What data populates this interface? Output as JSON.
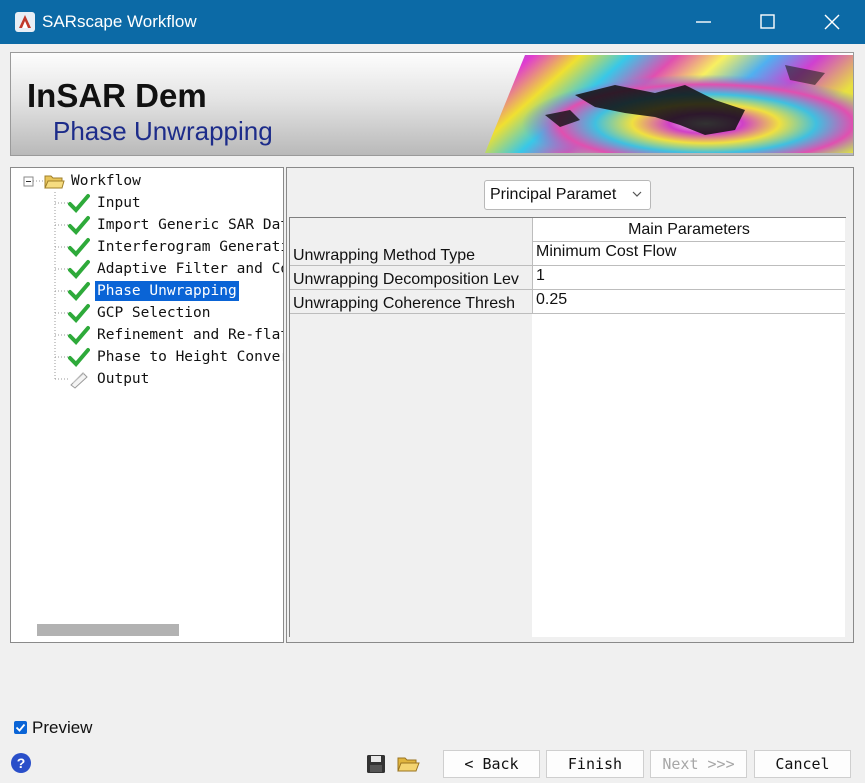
{
  "window": {
    "title": "SARscape Workflow"
  },
  "banner": {
    "title": "InSAR Dem",
    "subtitle": "Phase Unwrapping"
  },
  "tree": {
    "root": "Workflow",
    "items": [
      {
        "label": "Input",
        "status": "done"
      },
      {
        "label": "Import Generic SAR Data",
        "status": "done"
      },
      {
        "label": "Interferogram Generation",
        "status": "done"
      },
      {
        "label": "Adaptive Filter and Coh",
        "status": "done"
      },
      {
        "label": "Phase Unwrapping",
        "status": "done",
        "selected": true
      },
      {
        "label": "GCP Selection",
        "status": "done"
      },
      {
        "label": "Refinement and Re-flatt",
        "status": "done"
      },
      {
        "label": "Phase to Height Convers",
        "status": "done"
      },
      {
        "label": "Output",
        "status": "pending"
      }
    ]
  },
  "params": {
    "selector": "Principal Paramet",
    "header": "Main Parameters",
    "rows": [
      {
        "label": "Unwrapping Method Type",
        "value": "Minimum Cost Flow"
      },
      {
        "label": "Unwrapping Decomposition Lev",
        "value": "1"
      },
      {
        "label": "Unwrapping Coherence Thresh",
        "value": "0.25"
      }
    ]
  },
  "footer": {
    "preview_label": "Preview",
    "preview_checked": true,
    "help": "?",
    "back": "< Back",
    "finish": "Finish",
    "next": "Next >>>",
    "cancel": "Cancel"
  },
  "colors": {
    "titlebar": "#0c6aa6",
    "selection": "#0a64d6",
    "check": "#2eaa3a",
    "subtitle": "#1d2c8a"
  }
}
